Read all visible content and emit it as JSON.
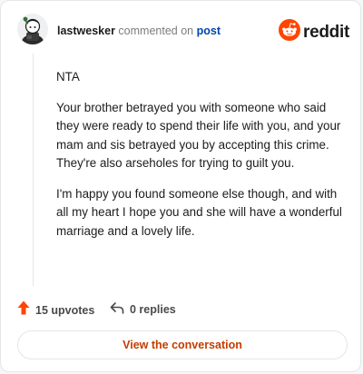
{
  "comment": {
    "username": "lastwesker",
    "action_text": "commented on",
    "post_link_text": "post",
    "paragraphs": [
      "NTA",
      "Your brother betrayed you with someone who said they were ready to spend their life with you, and your mam and sis betrayed you by accepting this crime. They're also arseholes for trying to guilt you.",
      "I'm happy you found someone else though, and with all my heart I hope you and she will have a wonderful marriage and a lovely life."
    ]
  },
  "brand": {
    "wordmark": "reddit",
    "icon": "reddit-snoo-icon",
    "color": "#ff4500"
  },
  "stats": {
    "upvotes_label": "15 upvotes",
    "upvote_icon": "upvote-arrow-icon",
    "upvote_color": "#ff4500",
    "replies_label": "0 replies",
    "reply_icon": "reply-arrow-icon"
  },
  "cta": {
    "label": "View the conversation",
    "color": "#c43c00"
  }
}
